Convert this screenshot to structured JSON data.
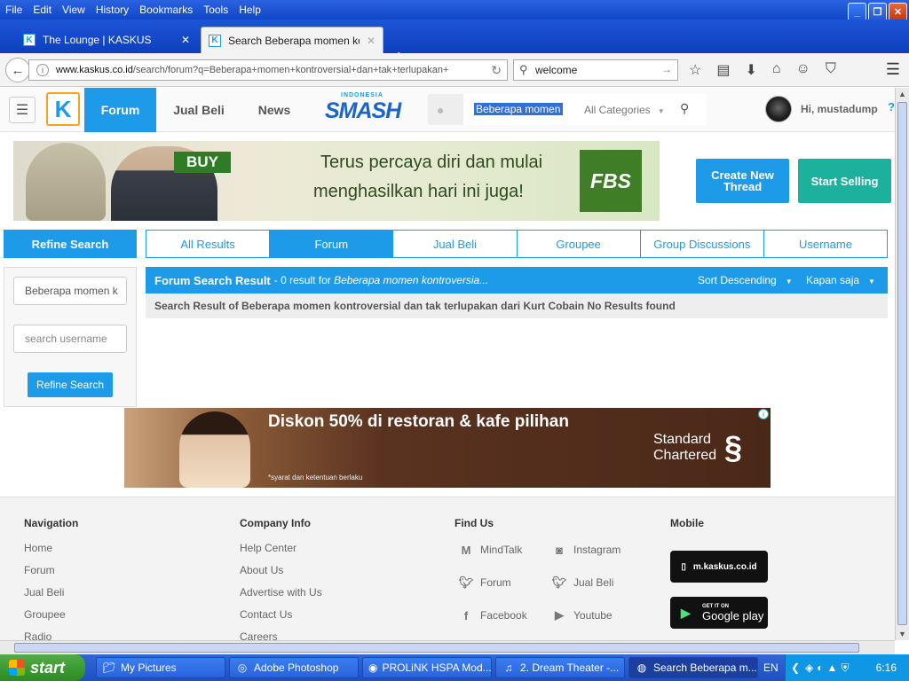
{
  "browser": {
    "menu": [
      "File",
      "Edit",
      "View",
      "History",
      "Bookmarks",
      "Tools",
      "Help"
    ],
    "tabs": [
      {
        "title": "The Lounge | KASKUS",
        "active": false
      },
      {
        "title": "Search Beberapa momen kont...",
        "active": true
      }
    ],
    "url_host": "www.kaskus.co.id",
    "url_path": "/search/forum?q=Beberapa+momen+kontroversial+dan+tak+terlupakan+",
    "search_value": "welcome"
  },
  "site": {
    "nav": [
      "Forum",
      "Jual Beli",
      "News"
    ],
    "smash_top": "INDONESIA",
    "smash_text": "SMASH",
    "search_query": "Beberapa momen kontroversial",
    "categories": "All Categories",
    "user_greeting": "Hi, mustadump"
  },
  "banner": {
    "buy": "BUY",
    "line1": "Terus percaya diri dan mulai",
    "line2": "menghasilkan hari ini juga!",
    "brand": "FBS"
  },
  "actions": {
    "create_thread": "Create New Thread",
    "start_selling": "Start Selling"
  },
  "refine": {
    "header": "Refine Search",
    "query_value": "Beberapa momen k",
    "username_placeholder": "search username",
    "button": "Refine Search"
  },
  "search_tabs": [
    "All Results",
    "Forum",
    "Jual Beli",
    "Groupee",
    "Group Discussions",
    "Username"
  ],
  "results": {
    "title": "Forum Search Result",
    "count_text": " - 0 result for ",
    "query_italic": "Beberapa momen kontroversia...",
    "sort": "Sort Descending",
    "time": "Kapan saja",
    "message": "Search Result of Beberapa momen kontroversial dan tak terlupakan dari Kurt Cobain No Results found"
  },
  "ad2": {
    "headline": "Diskon 50% di restoran & kafe pilihan",
    "small": "*syarat dan ketentuan berlaku",
    "brand_line1": "Standard",
    "brand_line2": "Chartered"
  },
  "footer": {
    "navigation": {
      "title": "Navigation",
      "links": [
        "Home",
        "Forum",
        "Jual Beli",
        "Groupee",
        "Radio"
      ]
    },
    "company": {
      "title": "Company Info",
      "links": [
        "Help Center",
        "About Us",
        "Advertise with Us",
        "Contact Us",
        "Careers"
      ]
    },
    "findus": {
      "title": "Find Us",
      "links": [
        "MindTalk",
        "Instagram",
        "Forum",
        "Jual Beli",
        "Facebook",
        "Youtube"
      ]
    },
    "mobile": {
      "title": "Mobile",
      "site": "m.kaskus.co.id",
      "play_top": "GET IT ON",
      "play": "Google play"
    }
  },
  "taskbar": {
    "start": "start",
    "items": [
      "My Pictures",
      "Adobe Photoshop",
      "PROLiNK HSPA Mod...",
      "2. Dream Theater -...",
      "Search Beberapa m..."
    ],
    "lang": "EN",
    "time": "6:16"
  }
}
